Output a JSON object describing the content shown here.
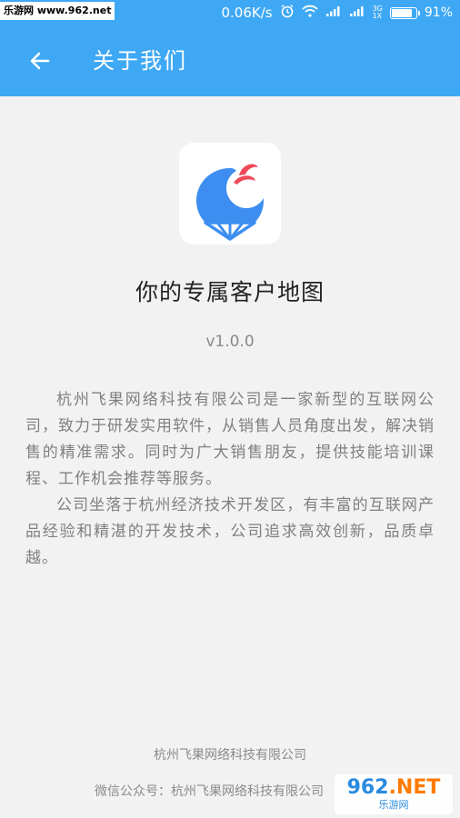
{
  "status_bar": {
    "watermark": "乐游网 www.962.net",
    "speed": "0.06K/s",
    "net_top": "3G",
    "net_bottom": "1X",
    "battery_percent": "91%",
    "battery_level": 0.91
  },
  "app_bar": {
    "title": "关于我们",
    "back_icon": "arrow-left-icon"
  },
  "app": {
    "name": "你的专属客户地图",
    "version": "v1.0.0",
    "logo_icon": "map-pin-logo-icon"
  },
  "description": {
    "paragraphs": [
      "杭州飞果网络科技有限公司是一家新型的互联网公司，致力于研发实用软件，从销售人员角度出发，解决销售的精准需求。同时为广大销售朋友，提供技能培训课程、工作机会推荐等服务。",
      "公司坐落于杭州经济技术开发区，有丰富的互联网产品经验和精湛的开发技术，公司追求高效创新，品质卓越。"
    ]
  },
  "footer": {
    "company": "杭州飞果网络科技有限公司",
    "wechat": "微信公众号：杭州飞果网络科技有限公司"
  },
  "watermark_bottom": {
    "big_prefix": "962",
    "big_suffix": ".NET",
    "small": "乐游网"
  },
  "colors": {
    "primary": "#3fa8f4",
    "logo_blue": "#3d8ef0",
    "logo_red": "#f04a5a"
  }
}
